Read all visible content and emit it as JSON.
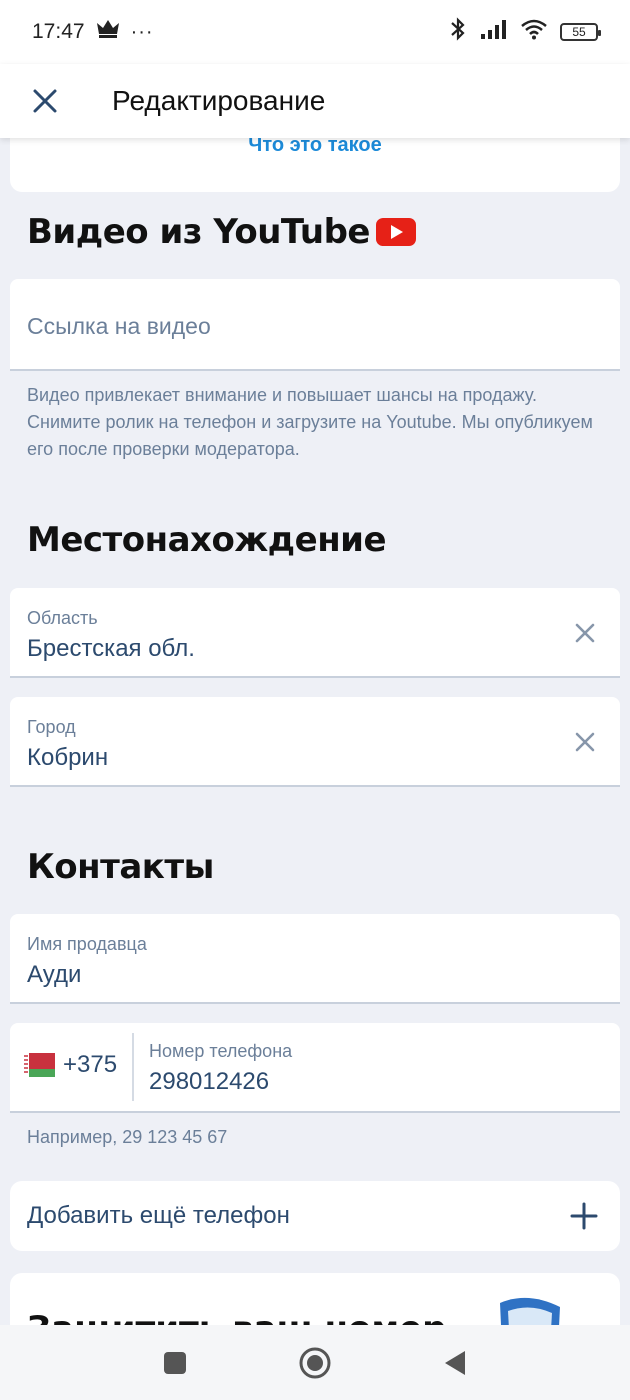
{
  "status_bar": {
    "time": "17:47",
    "dots": "···",
    "battery": "55"
  },
  "app_bar": {
    "title": "Редактирование"
  },
  "top_link": "Что это такое",
  "youtube_section": {
    "title": "Видео из YouTube",
    "input_placeholder": "Ссылка на видео",
    "help": "Видео привлекает внимание и повышает шансы на продажу. Снимите ролик на телефон и загрузите на Youtube. Мы опубликуем его после проверки модератора."
  },
  "location_section": {
    "title": "Местонахождение",
    "region": {
      "label": "Область",
      "value": "Брестская обл."
    },
    "city": {
      "label": "Город",
      "value": "Кобрин"
    }
  },
  "contacts_section": {
    "title": "Контакты",
    "seller": {
      "label": "Имя продавца",
      "value": "Ауди"
    },
    "phone": {
      "country_code": "+375",
      "label": "Номер телефона",
      "value": "298012426",
      "hint": "Например, 29 123 45 67"
    },
    "add_phone_label": "Добавить ещё телефон"
  },
  "promo": {
    "title": "Защитить ваш номер"
  },
  "colors": {
    "accent": "#2c4a6e",
    "link": "#1c8ad8",
    "youtube_red": "#e62117",
    "background": "#eef0f6"
  }
}
